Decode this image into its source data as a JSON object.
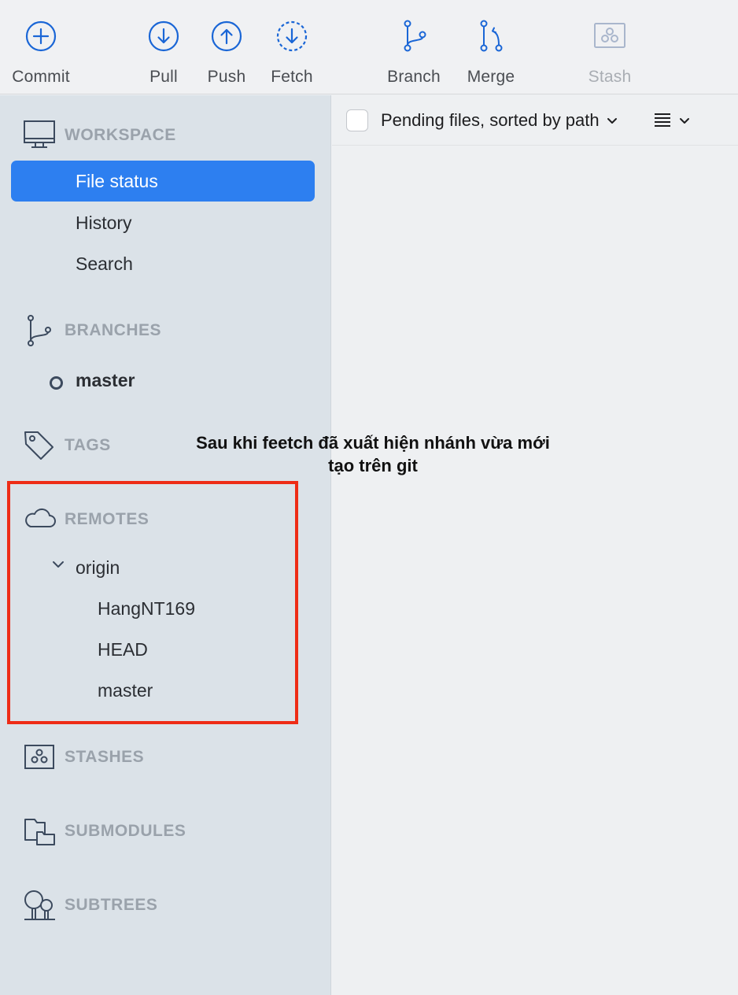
{
  "toolbar": {
    "commit": "Commit",
    "pull": "Pull",
    "push": "Push",
    "fetch": "Fetch",
    "branch": "Branch",
    "merge": "Merge",
    "stash": "Stash"
  },
  "sidebar": {
    "workspace": {
      "title": "WORKSPACE",
      "items": [
        "File status",
        "History",
        "Search"
      ]
    },
    "branches": {
      "title": "BRANCHES",
      "items": [
        "master"
      ]
    },
    "tags": {
      "title": "TAGS"
    },
    "remotes": {
      "title": "REMOTES",
      "origin": "origin",
      "items": [
        "HangNT169",
        "HEAD",
        "master"
      ]
    },
    "stashes": {
      "title": "STASHES"
    },
    "submodules": {
      "title": "SUBMODULES"
    },
    "subtrees": {
      "title": "SUBTREES"
    }
  },
  "pane": {
    "sort_label": "Pending files, sorted by path"
  },
  "annotation": {
    "line1": "Sau khi feetch đã xuất hiện nhánh vừa mới",
    "line2": "tạo trên git"
  },
  "colors": {
    "accent": "#2d7ff0",
    "highlight_box": "#ee2c16",
    "icon_blue": "#1a66d6"
  }
}
